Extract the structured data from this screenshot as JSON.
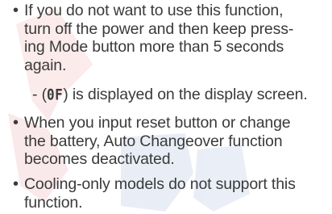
{
  "bullets": [
    {
      "marker": "•",
      "text": "If you do not want to use this function,\nturn off the power and then keep press-\ning Mode button more than 5 seconds\nagain."
    },
    {
      "marker": "•",
      "text": "When you input reset button or change\nthe battery, Auto Changeover function\nbecomes deactivated."
    },
    {
      "marker": "•",
      "text": "Cooling-only models do not support this\nfunction."
    }
  ],
  "subnote": {
    "prefix": "- (",
    "code": "0F",
    "suffix": ") is displayed on the display screen."
  },
  "colors": {
    "text": "#3a3a3a",
    "watermark_red": "#d9363e",
    "watermark_blue": "#2f5fb0"
  }
}
